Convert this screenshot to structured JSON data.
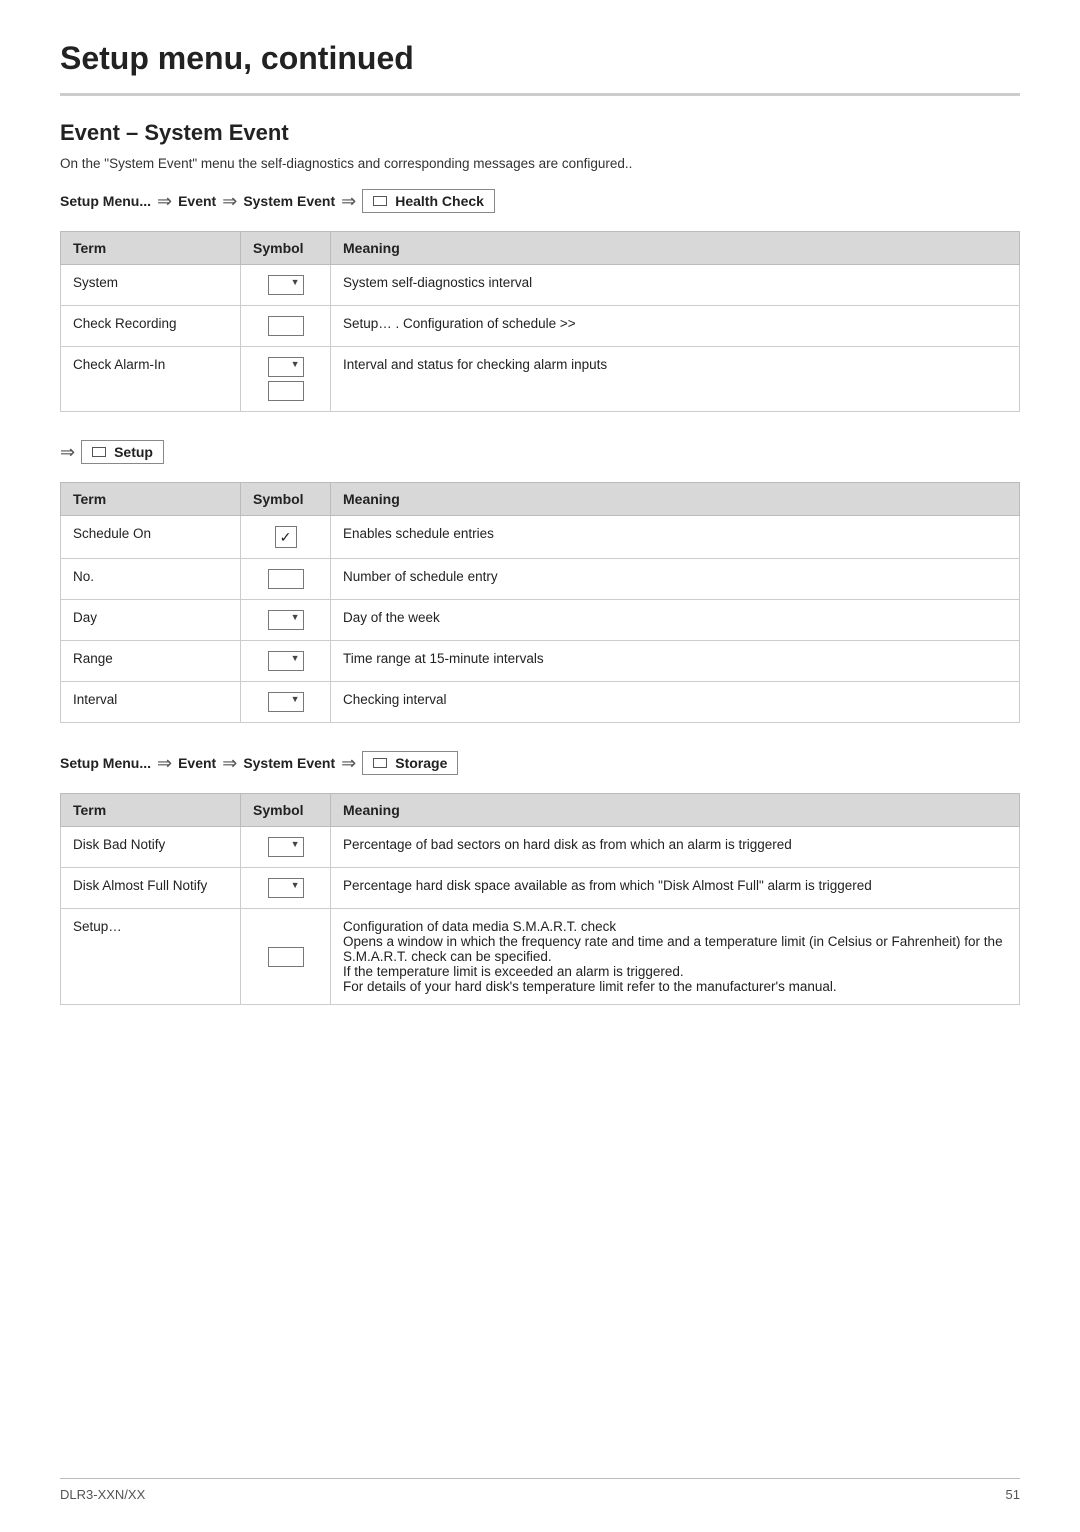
{
  "page": {
    "title": "Setup menu, continued",
    "footer_left": "DLR3-XXN/XX",
    "footer_right": "51"
  },
  "section": {
    "title": "Event – System Event",
    "description": "On the \"System Event\" menu the self-diagnostics and corresponding messages are configured.."
  },
  "breadcrumb1": {
    "items": [
      "Setup Menu...",
      "Event",
      "System Event",
      "Health Check"
    ]
  },
  "table1": {
    "headers": [
      "Term",
      "Symbol",
      "Meaning"
    ],
    "rows": [
      {
        "term": "System",
        "symbol": "dropdown",
        "meaning": "System self-diagnostics interval"
      },
      {
        "term": "Check Recording",
        "symbol": "box",
        "meaning": "Setup… . Configuration of schedule >>"
      },
      {
        "term": "Check Alarm-In",
        "symbol": "stacked-dropdown-box",
        "meaning": "Interval and status for checking alarm inputs"
      }
    ]
  },
  "sub_breadcrumb": {
    "label": "Setup"
  },
  "table2": {
    "headers": [
      "Term",
      "Symbol",
      "Meaning"
    ],
    "rows": [
      {
        "term": "Schedule On",
        "symbol": "checkmark",
        "meaning": "Enables schedule entries"
      },
      {
        "term": "No.",
        "symbol": "box",
        "meaning": "Number of schedule entry"
      },
      {
        "term": "Day",
        "symbol": "dropdown",
        "meaning": "Day of the week"
      },
      {
        "term": "Range",
        "symbol": "dropdown",
        "meaning": "Time range at 15-minute intervals"
      },
      {
        "term": "Interval",
        "symbol": "dropdown",
        "meaning": "Checking interval"
      }
    ]
  },
  "breadcrumb2": {
    "items": [
      "Setup Menu...",
      "Event",
      "System Event",
      "Storage"
    ]
  },
  "table3": {
    "headers": [
      "Term",
      "Symbol",
      "Meaning"
    ],
    "rows": [
      {
        "term": "Disk Bad Notify",
        "symbol": "dropdown",
        "meaning": "Percentage of bad sectors on hard disk as from which an alarm is triggered"
      },
      {
        "term": "Disk Almost Full Notify",
        "symbol": "dropdown",
        "meaning": "Percentage hard disk space available as from which \"Disk Almost Full\" alarm is triggered"
      },
      {
        "term": "Setup…",
        "symbol": "box",
        "meaning": "Configuration of data media S.M.A.R.T. check\nOpens a window in which the frequency rate and time and a temperature limit (in Celsius or Fahrenheit) for the S.M.A.R.T. check can be specified.\nIf the temperature limit is exceeded an alarm is triggered.\nFor details of your hard disk's temperature limit refer to the manufacturer's manual."
      }
    ]
  }
}
